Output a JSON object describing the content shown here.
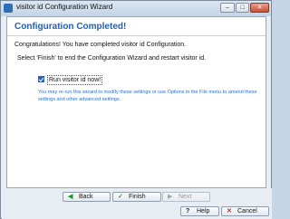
{
  "window": {
    "title": "visitor id Configuration Wizard",
    "minimize_glyph": "–",
    "maximize_glyph": "□",
    "close_glyph": "✕"
  },
  "content": {
    "heading": "Configuration Completed!",
    "congrats": "Congratulations! You have completed visitor id Configuration.",
    "instruction": "Select 'Finish' to end the Configuration Wizard and restart visitor id.",
    "checkbox_label": "Run visitor id now!",
    "checkbox_checked": true,
    "note": "You may re-run this wizard to modify these settings or use Options in the File menu to amend these settings and other advanced settings."
  },
  "buttons": {
    "back": "Back",
    "finish": "Finish",
    "next": "Next",
    "help": "Help",
    "cancel": "Cancel"
  },
  "icons": {
    "back": "arrow-left-icon",
    "finish": "check-icon",
    "next": "arrow-right-icon",
    "help": "question-icon",
    "cancel": "x-icon"
  }
}
